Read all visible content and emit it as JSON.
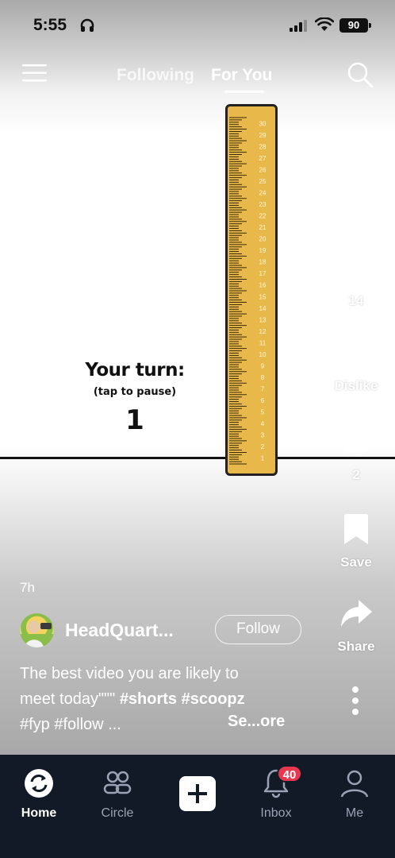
{
  "status_bar": {
    "time": "5:55",
    "battery": "90"
  },
  "top_nav": {
    "following": "Following",
    "for_you": "For You"
  },
  "video": {
    "title": "Your turn:",
    "subtitle": "(tap to pause)",
    "counter": "1",
    "ruler_numbers": [
      "30",
      "29",
      "28",
      "27",
      "26",
      "25",
      "24",
      "23",
      "22",
      "21",
      "20",
      "19",
      "18",
      "17",
      "16",
      "15",
      "14",
      "13",
      "12",
      "11",
      "10",
      "9",
      "8",
      "7",
      "6",
      "5",
      "4",
      "3",
      "2",
      "1"
    ]
  },
  "actions": {
    "like_count": "14",
    "dislike_label": "Dislike",
    "comment_count": "2",
    "save_label": "Save",
    "share_label": "Share"
  },
  "post": {
    "age": "7h",
    "channel": "HeadQuart...",
    "follow_label": "Follow",
    "desc_line1": "The best video you are likely to",
    "desc_line2_prefix": "meet today\"\"\" ",
    "desc_line2_tags": "#shorts #scoopz",
    "desc_line3": "#fyp #follow ...",
    "see_more": "Se...ore"
  },
  "bottom_nav": {
    "home": "Home",
    "circle": "Circle",
    "inbox": "Inbox",
    "inbox_badge": "40",
    "me": "Me"
  },
  "colors": {
    "ruler_fill": "#e8b84a",
    "nav_bg": "#111a26",
    "badge": "#e8384f"
  }
}
